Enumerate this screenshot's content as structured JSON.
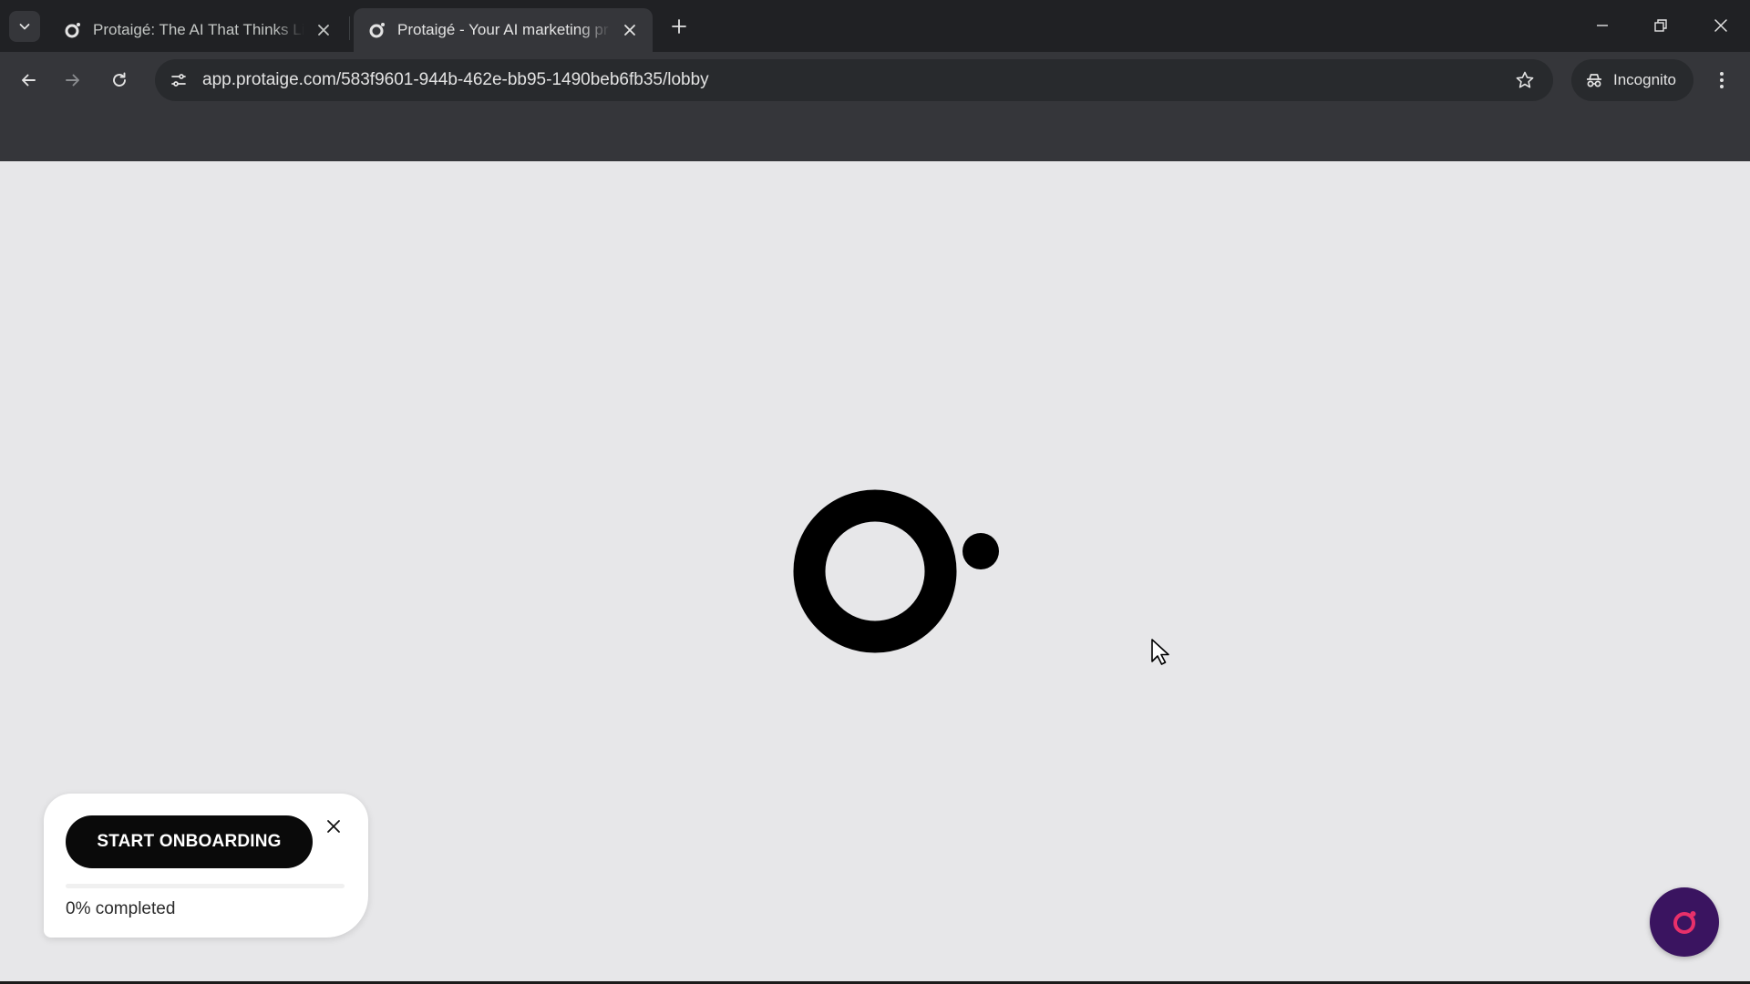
{
  "browser": {
    "tabs": [
      {
        "title": "Protaigé: The AI That Thinks Lik",
        "active": false,
        "favicon": "protaige-favicon"
      },
      {
        "title": "Protaigé - Your AI marketing pr",
        "active": true,
        "favicon": "protaige-favicon"
      }
    ],
    "address_bar": {
      "url": "app.protaige.com/583f9601-944b-462e-bb95-1490beb6fb35/lobby"
    },
    "incognito_label": "Incognito",
    "icons": {
      "tab_search": "chevron-down-icon",
      "new_tab": "plus-icon",
      "minimize": "minimize-icon",
      "restore": "restore-icon",
      "close": "close-icon",
      "back": "arrow-left-icon",
      "forward": "arrow-right-icon",
      "reload": "reload-icon",
      "site_info": "tune-icon",
      "bookmark": "star-icon",
      "incognito": "incognito-icon",
      "menu": "kebab-menu-icon"
    }
  },
  "page": {
    "loader": "protaige-logo",
    "onboarding": {
      "button_label": "START ONBOARDING",
      "progress_text": "0% completed",
      "progress_fraction": 0
    },
    "chat_button_icon": "chat-icon"
  },
  "colors": {
    "tabstrip": "#202124",
    "toolbar": "#35363a",
    "page_background": "#e7e7e9",
    "chat_fab": "#3a1460",
    "chat_icon_accent": "#e8306a"
  }
}
